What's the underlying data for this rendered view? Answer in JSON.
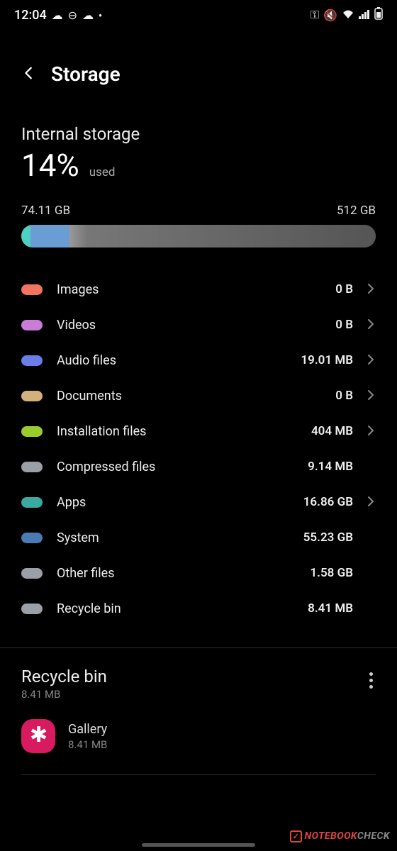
{
  "status": {
    "time": "12:04"
  },
  "header": {
    "title": "Storage"
  },
  "internal": {
    "label": "Internal storage",
    "percent": "14%",
    "percent_suffix": "used",
    "used": "74.11 GB",
    "total": "512 GB"
  },
  "categories": [
    {
      "label": "Images",
      "size": "0 B",
      "color": "#f27360",
      "nav": true
    },
    {
      "label": "Videos",
      "size": "0 B",
      "color": "#c97dd8",
      "nav": true
    },
    {
      "label": "Audio files",
      "size": "19.01 MB",
      "color": "#6a7de8",
      "nav": true
    },
    {
      "label": "Documents",
      "size": "0 B",
      "color": "#d3b07c",
      "nav": true
    },
    {
      "label": "Installation files",
      "size": "404 MB",
      "color": "#9acc2e",
      "nav": true
    },
    {
      "label": "Compressed files",
      "size": "9.14 MB",
      "color": "#9aa0a6",
      "nav": false
    },
    {
      "label": "Apps",
      "size": "16.86 GB",
      "color": "#3aa99f",
      "nav": true
    },
    {
      "label": "System",
      "size": "55.23 GB",
      "color": "#4a7bb5",
      "nav": false
    },
    {
      "label": "Other files",
      "size": "1.58 GB",
      "color": "#9aa0a6",
      "nav": false
    },
    {
      "label": "Recycle bin",
      "size": "8.41 MB",
      "color": "#9aa0a6",
      "nav": false
    }
  ],
  "recycle": {
    "title": "Recycle bin",
    "subtitle": "8.41 MB",
    "apps": [
      {
        "name": "Gallery",
        "size": "8.41 MB"
      }
    ]
  },
  "watermark": {
    "brand": "NOTEBOOK",
    "suffix": "CHECK"
  }
}
